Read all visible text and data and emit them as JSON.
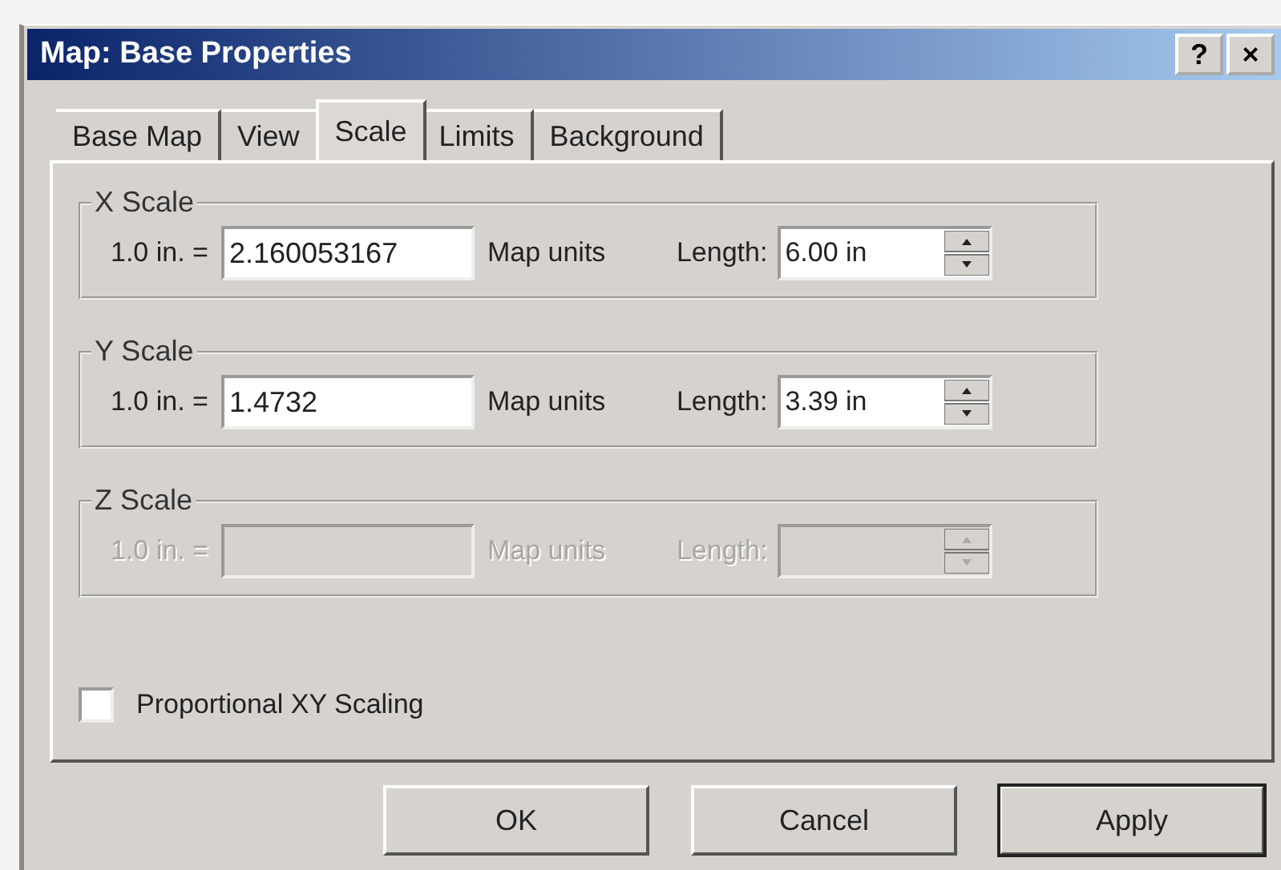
{
  "window": {
    "title": "Map: Base Properties",
    "help_button": "?",
    "close_button": "×"
  },
  "tabs": [
    {
      "label": "Base Map",
      "selected": false
    },
    {
      "label": "View",
      "selected": false
    },
    {
      "label": "Scale",
      "selected": true
    },
    {
      "label": "Limits",
      "selected": false
    },
    {
      "label": "Background",
      "selected": false
    }
  ],
  "scales": [
    {
      "title": "X Scale",
      "prefix": "1.0 in. =",
      "value": "2.160053167",
      "units": "Map units",
      "length_label": "Length:",
      "length": "6.00 in",
      "disabled": false
    },
    {
      "title": "Y Scale",
      "prefix": "1.0 in. =",
      "value": "1.4732",
      "units": "Map units",
      "length_label": "Length:",
      "length": "3.39 in",
      "disabled": false
    },
    {
      "title": "Z Scale",
      "prefix": "1.0 in. =",
      "units": "Map units",
      "length_label": "Length:",
      "disabled": true
    }
  ],
  "proportional": {
    "label": "Proportional XY Scaling",
    "checked": false
  },
  "buttons": [
    {
      "label": "OK",
      "default": false
    },
    {
      "label": "Cancel",
      "default": false
    },
    {
      "label": "Apply",
      "default": true
    }
  ]
}
